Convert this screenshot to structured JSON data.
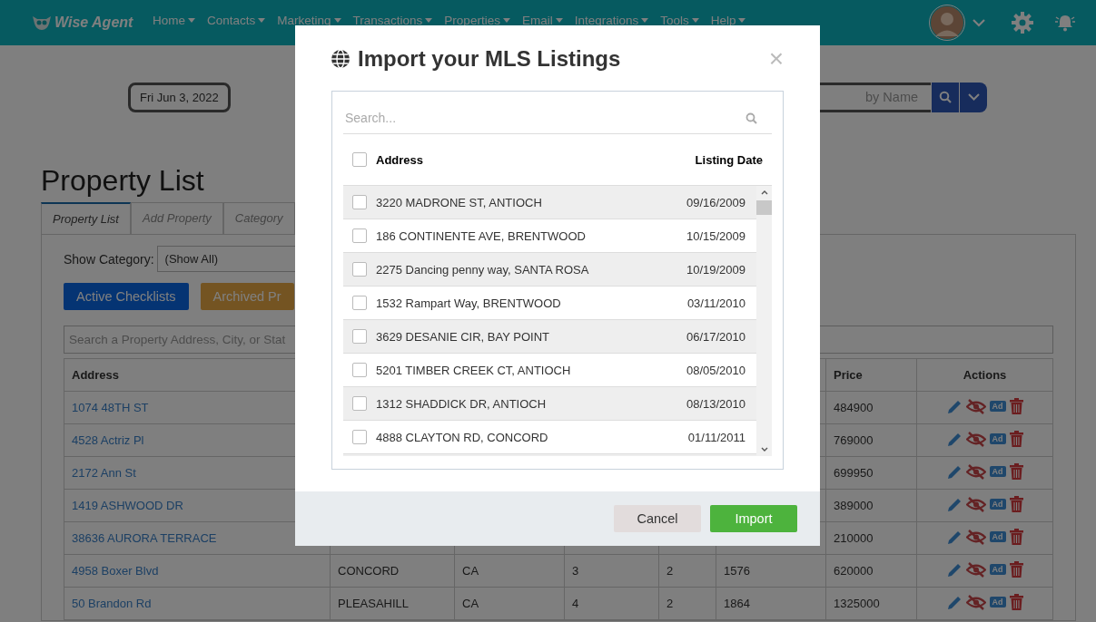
{
  "nav": {
    "logo": "Wise Agent",
    "menu": [
      {
        "label": "Home"
      },
      {
        "label": "Contacts"
      },
      {
        "label": "Marketing"
      },
      {
        "label": "Transactions"
      },
      {
        "label": "Properties"
      },
      {
        "label": "Email"
      },
      {
        "label": "Integrations"
      },
      {
        "label": "Tools"
      },
      {
        "label": "Help"
      }
    ]
  },
  "date_chip": "Fri Jun 3, 2022",
  "contact_search": {
    "placeholder": "by Name"
  },
  "page_title": "Property List",
  "tabs": [
    {
      "label": "Property List",
      "selected": true
    },
    {
      "label": "Add Property",
      "selected": false
    },
    {
      "label": "Category",
      "selected": false
    }
  ],
  "category_filter": {
    "label": "Show Category:",
    "value": "(Show All)"
  },
  "buttons": [
    {
      "label": "Active Checklists",
      "kind": "primary"
    },
    {
      "label": "Archived Pr",
      "kind": "warning"
    }
  ],
  "property_search": {
    "placeholder": "Search a Property Address, City, or Stat"
  },
  "table": {
    "headers": {
      "address": "Address",
      "price": "Price",
      "actions": "Actions"
    },
    "rows": [
      {
        "address": "1074 48TH ST",
        "price": "484900",
        "ad_badge": "Ad"
      },
      {
        "address": "4528 Actriz Pl",
        "price": "769000",
        "ad_badge": "Ad"
      },
      {
        "address": "2172 Ann St",
        "price": "699950",
        "ad_badge": "Ad"
      },
      {
        "address": "1419 ASHWOOD DR",
        "price": "389000",
        "ad_badge": "Ad"
      },
      {
        "address": "38636 AURORA TERRACE",
        "price": "210000",
        "ad_badge": "Ad"
      },
      {
        "address": "4958 Boxer Blvd",
        "city": "CONCORD",
        "state": "CA",
        "beds": "3",
        "baths": "2",
        "sqft": "1576",
        "price": "620000",
        "ad_badge": "Ad"
      },
      {
        "address": "50 Brandon Rd",
        "city": "PLEASAHILL",
        "state": "CA",
        "beds": "4",
        "baths": "2",
        "sqft": "1864",
        "price": "1325000",
        "ad_badge": "Ad"
      }
    ]
  },
  "modal": {
    "title": "Import your MLS Listings",
    "close": "×",
    "search": {
      "placeholder": "Search..."
    },
    "header": {
      "address": "Address",
      "date": "Listing Date",
      "checked": false
    },
    "listings": [
      {
        "address": "3220 MADRONE ST, ANTIOCH",
        "date": "09/16/2009",
        "checked": false
      },
      {
        "address": "186 CONTINENTE AVE, BRENTWOOD",
        "date": "10/15/2009",
        "checked": false
      },
      {
        "address": "2275 Dancing penny way, SANTA ROSA",
        "date": "10/19/2009",
        "checked": false
      },
      {
        "address": "1532 Rampart Way, BRENTWOOD",
        "date": "03/11/2010",
        "checked": false
      },
      {
        "address": "3629 DESANIE CIR, BAY POINT",
        "date": "06/17/2010",
        "checked": false
      },
      {
        "address": "5201 TIMBER CREEK CT, ANTIOCH",
        "date": "08/05/2010",
        "checked": false
      },
      {
        "address": "1312 SHADDICK DR, ANTIOCH",
        "date": "08/13/2010",
        "checked": false
      },
      {
        "address": "4888 CLAYTON RD, CONCORD",
        "date": "01/11/2011",
        "checked": false
      }
    ],
    "buttons": [
      {
        "label": "Cancel",
        "kind": "secondary"
      },
      {
        "label": "Import",
        "kind": "success"
      }
    ]
  }
}
